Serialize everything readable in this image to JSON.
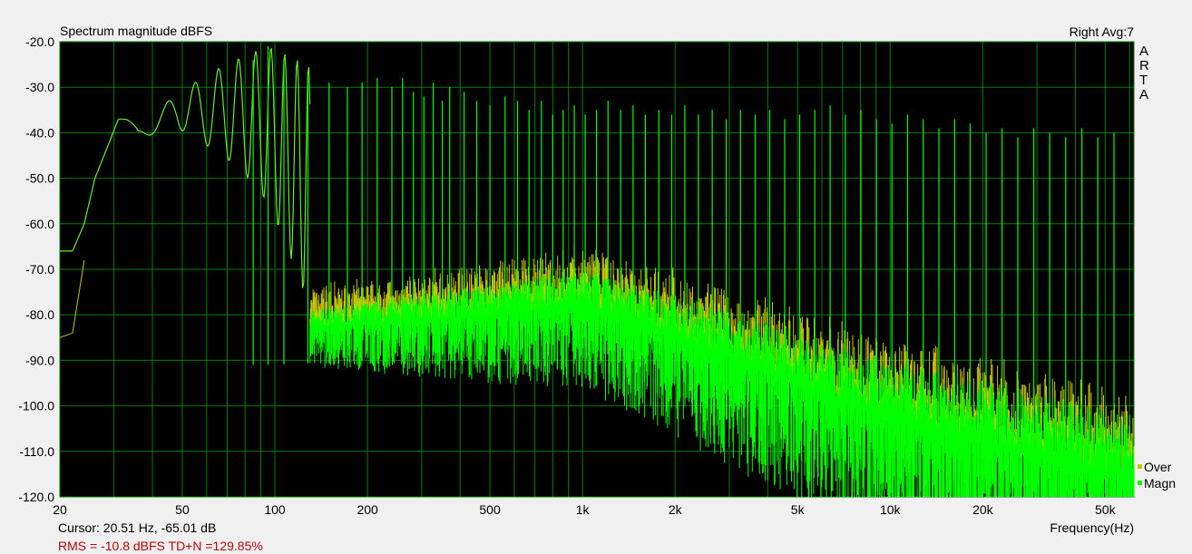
{
  "chart_data": {
    "type": "line",
    "title": "Spectrum magnitude dBFS",
    "top_right_label": "Right  Avg:7",
    "xlabel": "Frequency(Hz)",
    "x_scale": "log",
    "xlim": [
      20,
      62000
    ],
    "ylim": [
      -120,
      -20
    ],
    "grid": true,
    "background": "#000000",
    "grid_color": "#008000",
    "y_ticks": [
      {
        "value": -20,
        "label": "-20.0"
      },
      {
        "value": -30,
        "label": "-30.0"
      },
      {
        "value": -40,
        "label": "-40.0"
      },
      {
        "value": -50,
        "label": "-50.0"
      },
      {
        "value": -60,
        "label": "-60.0"
      },
      {
        "value": -70,
        "label": "-70.0"
      },
      {
        "value": -80,
        "label": "-80.0"
      },
      {
        "value": -90,
        "label": "-90.0"
      },
      {
        "value": -100,
        "label": "-100.0"
      },
      {
        "value": -110,
        "label": "-110.0"
      },
      {
        "value": -120,
        "label": "-120.0"
      }
    ],
    "x_ticks": [
      {
        "value": 20,
        "label": "20"
      },
      {
        "value": 50,
        "label": "50"
      },
      {
        "value": 100,
        "label": "100"
      },
      {
        "value": 200,
        "label": "200"
      },
      {
        "value": 500,
        "label": "500"
      },
      {
        "value": 1000,
        "label": "1k"
      },
      {
        "value": 2000,
        "label": "2k"
      },
      {
        "value": 5000,
        "label": "5k"
      },
      {
        "value": 10000,
        "label": "10k"
      },
      {
        "value": 20000,
        "label": "20k"
      },
      {
        "value": 50000,
        "label": "50k"
      }
    ],
    "legend_position": "bottom-right",
    "series": [
      {
        "name": "Magn",
        "color": "#00ff00",
        "envelope": [
          {
            "x": 20,
            "y": -66
          },
          {
            "x": 22,
            "y": -66
          },
          {
            "x": 24,
            "y": -60
          },
          {
            "x": 26,
            "y": -50
          },
          {
            "x": 29,
            "y": -42
          },
          {
            "x": 31,
            "y": -37
          },
          {
            "x": 33,
            "y": -37
          },
          {
            "x": 36,
            "y": -39
          },
          {
            "x": 40,
            "y": -36
          },
          {
            "x": 44,
            "y": -34
          },
          {
            "x": 48,
            "y": -30
          },
          {
            "x": 55,
            "y": -29
          },
          {
            "x": 65,
            "y": -26
          },
          {
            "x": 80,
            "y": -23
          },
          {
            "x": 95,
            "y": -21
          },
          {
            "x": 120,
            "y": -24
          },
          {
            "x": 150,
            "y": -27
          },
          {
            "x": 200,
            "y": -29
          },
          {
            "x": 300,
            "y": -31
          },
          {
            "x": 500,
            "y": -32
          },
          {
            "x": 1000,
            "y": -33
          },
          {
            "x": 2000,
            "y": -35
          },
          {
            "x": 5000,
            "y": -35
          },
          {
            "x": 10000,
            "y": -37
          },
          {
            "x": 20000,
            "y": -39
          },
          {
            "x": 60000,
            "y": -39
          }
        ],
        "peaks": [
          {
            "x": 85,
            "y": -24
          },
          {
            "x": 95,
            "y": -21
          },
          {
            "x": 107,
            "y": -24
          },
          {
            "x": 128,
            "y": -27
          },
          {
            "x": 150,
            "y": -29
          },
          {
            "x": 172,
            "y": -30
          },
          {
            "x": 192,
            "y": -29
          },
          {
            "x": 215,
            "y": -28
          },
          {
            "x": 240,
            "y": -30
          },
          {
            "x": 260,
            "y": -28
          },
          {
            "x": 282,
            "y": -31
          },
          {
            "x": 305,
            "y": -32
          },
          {
            "x": 327,
            "y": -29
          },
          {
            "x": 350,
            "y": -33
          },
          {
            "x": 370,
            "y": -30
          },
          {
            "x": 412,
            "y": -31
          },
          {
            "x": 453,
            "y": -33
          },
          {
            "x": 500,
            "y": -34
          },
          {
            "x": 560,
            "y": -32
          },
          {
            "x": 615,
            "y": -33
          },
          {
            "x": 670,
            "y": -35
          },
          {
            "x": 735,
            "y": -33
          },
          {
            "x": 800,
            "y": -36
          },
          {
            "x": 865,
            "y": -35
          },
          {
            "x": 940,
            "y": -34
          },
          {
            "x": 1020,
            "y": -36
          },
          {
            "x": 1110,
            "y": -35
          },
          {
            "x": 1210,
            "y": -33
          },
          {
            "x": 1330,
            "y": -35
          },
          {
            "x": 1460,
            "y": -34
          },
          {
            "x": 1600,
            "y": -36
          },
          {
            "x": 1770,
            "y": -35
          },
          {
            "x": 1950,
            "y": -36
          },
          {
            "x": 2150,
            "y": -34
          },
          {
            "x": 2380,
            "y": -36
          },
          {
            "x": 2640,
            "y": -35
          },
          {
            "x": 2930,
            "y": -37
          },
          {
            "x": 3260,
            "y": -35
          },
          {
            "x": 3640,
            "y": -36
          },
          {
            "x": 4060,
            "y": -35
          },
          {
            "x": 4540,
            "y": -37
          },
          {
            "x": 5080,
            "y": -36
          },
          {
            "x": 5690,
            "y": -35
          },
          {
            "x": 6380,
            "y": -34
          },
          {
            "x": 7150,
            "y": -36
          },
          {
            "x": 8030,
            "y": -35
          },
          {
            "x": 9020,
            "y": -37
          },
          {
            "x": 10130,
            "y": -38
          },
          {
            "x": 11390,
            "y": -36
          },
          {
            "x": 12800,
            "y": -37
          },
          {
            "x": 14400,
            "y": -39
          },
          {
            "x": 16200,
            "y": -37
          },
          {
            "x": 18200,
            "y": -38
          },
          {
            "x": 20500,
            "y": -40
          },
          {
            "x": 23100,
            "y": -39
          },
          {
            "x": 26000,
            "y": -41
          },
          {
            "x": 29300,
            "y": -39
          },
          {
            "x": 33000,
            "y": -40
          },
          {
            "x": 37200,
            "y": -41
          },
          {
            "x": 42000,
            "y": -39
          },
          {
            "x": 47300,
            "y": -41
          },
          {
            "x": 53400,
            "y": -40
          }
        ],
        "noise_floor": [
          {
            "x": 100,
            "y": -83
          },
          {
            "x": 200,
            "y": -82
          },
          {
            "x": 500,
            "y": -80
          },
          {
            "x": 1000,
            "y": -78
          },
          {
            "x": 2000,
            "y": -85
          },
          {
            "x": 5000,
            "y": -95
          },
          {
            "x": 10000,
            "y": -103
          },
          {
            "x": 20000,
            "y": -108
          },
          {
            "x": 50000,
            "y": -115
          }
        ]
      },
      {
        "name": "Over",
        "color": "#c8c800",
        "envelope": [
          {
            "x": 20,
            "y": -85
          },
          {
            "x": 22,
            "y": -84
          },
          {
            "x": 24,
            "y": -68
          },
          {
            "x": 200,
            "y": -80
          },
          {
            "x": 500,
            "y": -76
          },
          {
            "x": 900,
            "y": -70
          },
          {
            "x": 2000,
            "y": -80
          },
          {
            "x": 5000,
            "y": -88
          },
          {
            "x": 10000,
            "y": -97
          },
          {
            "x": 20000,
            "y": -100
          },
          {
            "x": 50000,
            "y": -112
          }
        ]
      }
    ]
  },
  "cursor_label": "Cursor: 20.51 Hz, -65.01 dB",
  "stats_label": "RMS =  -10.8 dBFS   TD+N =129.85%",
  "logo_letters": [
    "A",
    "R",
    "T",
    "A"
  ]
}
